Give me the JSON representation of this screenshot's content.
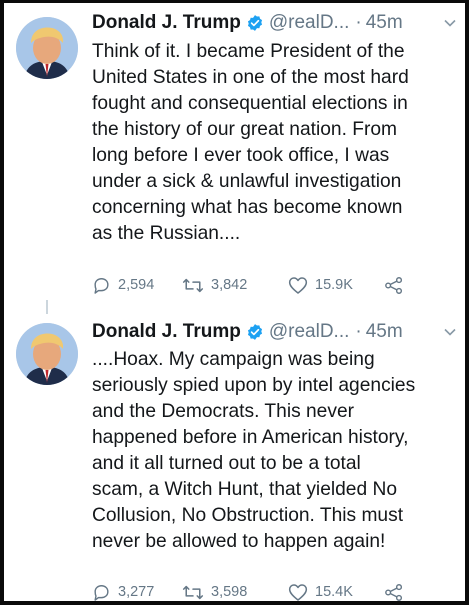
{
  "tweets": [
    {
      "author_name": "Donald J. Trump",
      "handle": "@realD...",
      "separator": "·",
      "time": "45m",
      "text": "Think of it. I became President of the\nUnited States in one of the most hard\nfought and consequential elections in\nthe history of our great nation. From\nlong before I ever took office, I was\nunder a sick & unlawful investigation\nconcerning what has become known\nas the Russian....",
      "replies": "2,594",
      "retweets": "3,842",
      "likes": "15.9K"
    },
    {
      "author_name": "Donald J. Trump",
      "handle": "@realD...",
      "separator": "·",
      "time": "45m",
      "text": "....Hoax. My campaign was being\nseriously spied upon by intel agencies\nand the Democrats. This never\nhappened before in American history,\nand it all turned out to be a total\nscam, a Witch Hunt, that yielded No\nCollusion, No Obstruction. This must\nnever be allowed to happen again!",
      "replies": "3,277",
      "retweets": "3,598",
      "likes": "15.4K"
    }
  ],
  "icons": {
    "verified": "verified-badge-icon",
    "caret": "chevron-down-icon",
    "reply": "reply-icon",
    "retweet": "retweet-icon",
    "like": "heart-icon",
    "share": "share-icon"
  },
  "colors": {
    "text": "#14171a",
    "secondary": "#657786",
    "verified": "#1da1f2",
    "border": "#0a0a0a"
  }
}
